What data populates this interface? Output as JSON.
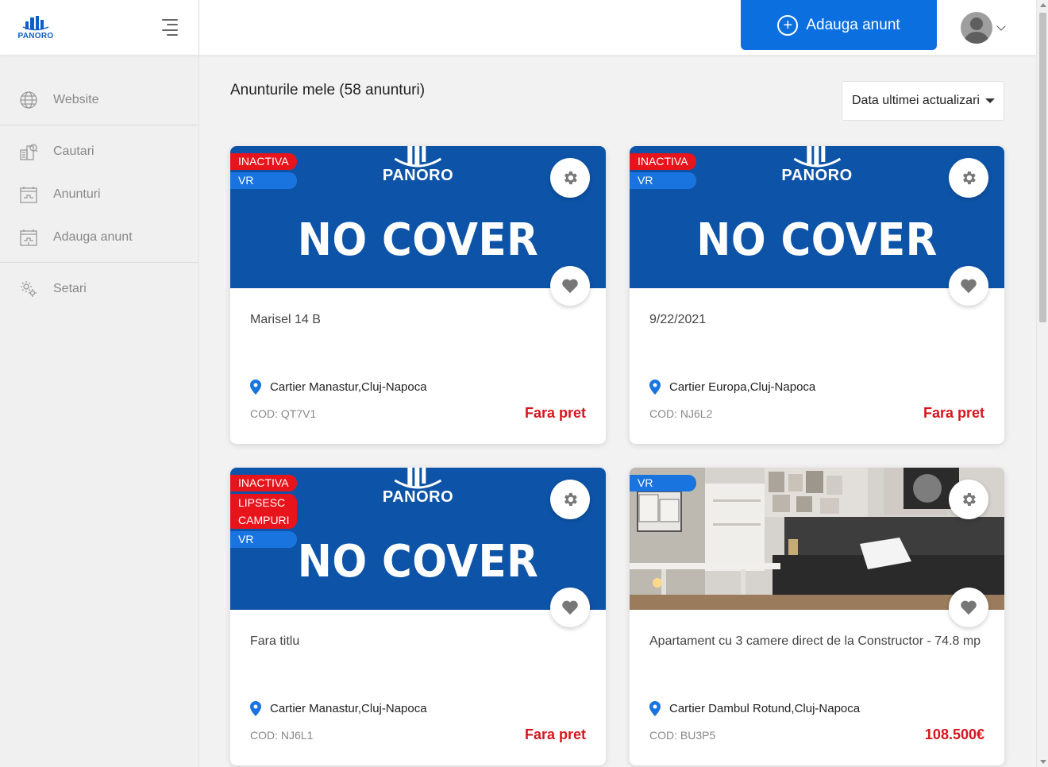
{
  "brand": {
    "logo_text": "PANORO"
  },
  "sidebar": {
    "items": [
      {
        "label": "Website",
        "icon": "globe-icon"
      },
      {
        "label": "Cautari",
        "icon": "search-building-icon"
      },
      {
        "label": "Anunturi",
        "icon": "listing-board-icon"
      },
      {
        "label": "Adauga anunt",
        "icon": "add-listing-icon"
      },
      {
        "label": "Setari",
        "icon": "gear-icon"
      }
    ]
  },
  "header": {
    "add_button_label": "Adauga anunt"
  },
  "main": {
    "title": "Anunturile mele (58 anunturi)",
    "sort_label": "Data ultimei actualizari"
  },
  "cards": [
    {
      "badges": [
        "INACTIVA",
        "VR"
      ],
      "cover_text": "NO COVER",
      "cover_logo": "PANORO",
      "title": "Marisel 14 B",
      "location": "Cartier Manastur,Cluj-Napoca",
      "code": "COD: QT7V1",
      "price": "Fara pret"
    },
    {
      "badges": [
        "INACTIVA",
        "VR"
      ],
      "cover_text": "NO COVER",
      "cover_logo": "PANORO",
      "title": "9/22/2021",
      "location": "Cartier Europa,Cluj-Napoca",
      "code": "COD: NJ6L2",
      "price": "Fara pret"
    },
    {
      "badges": [
        "INACTIVA",
        "LIPSESC CAMPURI",
        "VR"
      ],
      "cover_text": "NO COVER",
      "cover_logo": "PANORO",
      "title": "Fara titlu",
      "location": "Cartier Manastur,Cluj-Napoca",
      "code": "COD: NJ6L1",
      "price": "Fara pret"
    },
    {
      "badges": [
        "VR"
      ],
      "title": "Apartament cu 3 camere direct de la Constructor - 74.8 mp",
      "location": "Cartier Dambul Rotund,Cluj-Napoca",
      "code": "COD: BU3P5",
      "price": "108.500€"
    }
  ],
  "colors": {
    "accent": "#0b6fe0",
    "cover_blue": "#0d54a8",
    "inactive_red": "#e8141c",
    "price_red": "#d8141c"
  }
}
